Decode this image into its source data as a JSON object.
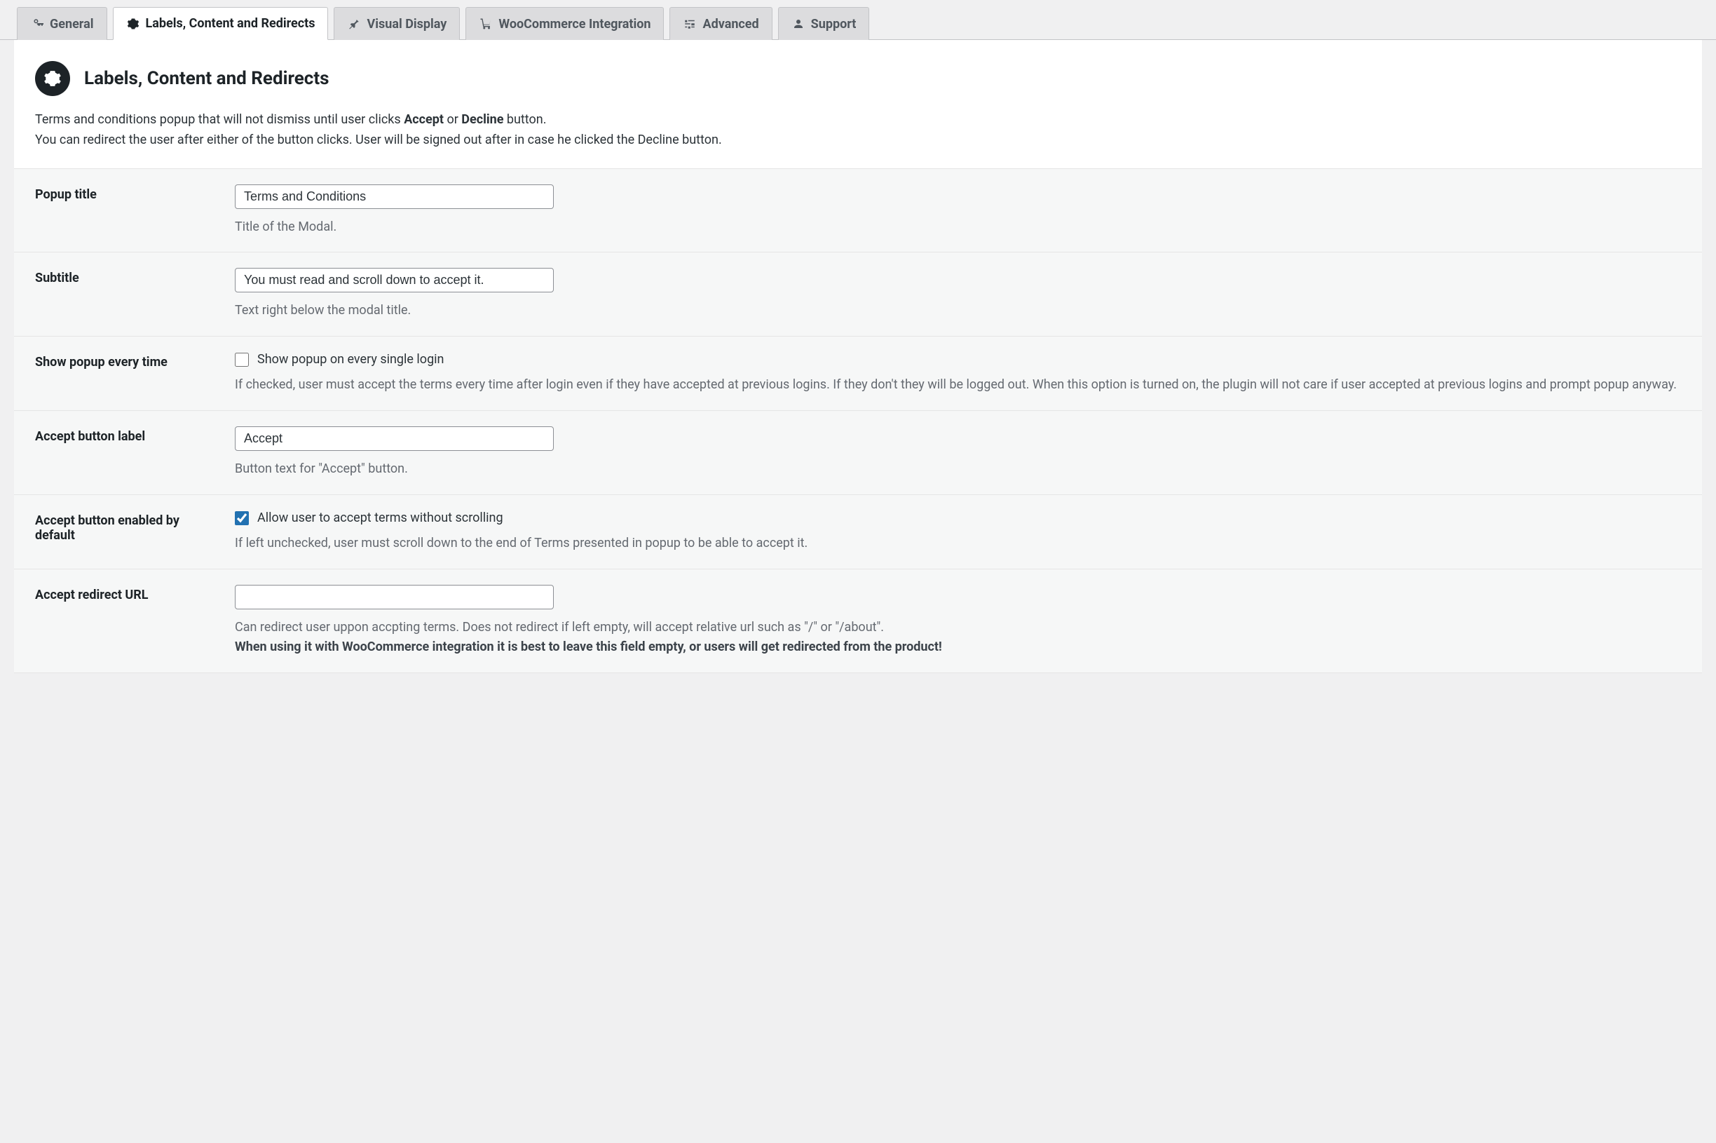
{
  "tabs": [
    {
      "label": "General"
    },
    {
      "label": "Labels, Content and Redirects"
    },
    {
      "label": "Visual Display"
    },
    {
      "label": "WooCommerce Integration"
    },
    {
      "label": "Advanced"
    },
    {
      "label": "Support"
    }
  ],
  "panel": {
    "title": "Labels, Content and Redirects",
    "desc_line1_pre": "Terms and conditions popup that will not dismiss until user clicks ",
    "desc_accept": "Accept",
    "desc_or": " or ",
    "desc_decline": "Decline",
    "desc_line1_post": " button.",
    "desc_line2": "You can redirect the user after either of the button clicks. User will be signed out after in case he clicked the Decline button."
  },
  "fields": {
    "popup_title": {
      "label": "Popup title",
      "value": "Terms and Conditions",
      "help": "Title of the Modal."
    },
    "subtitle": {
      "label": "Subtitle",
      "value": "You must read and scroll down to accept it.",
      "help": "Text right below the modal title."
    },
    "show_every_time": {
      "label": "Show popup every time",
      "checkbox_label": "Show popup on every single login",
      "help": "If checked, user must accept the terms every time after login even if they have accepted at previous logins. If they don't they will be logged out. When this option is turned on, the plugin will not care if user accepted at previous logins and prompt popup anyway."
    },
    "accept_label": {
      "label": "Accept button label",
      "value": "Accept",
      "help": "Button text for \"Accept\" button."
    },
    "accept_enabled": {
      "label": "Accept button enabled by default",
      "checkbox_label": "Allow user to accept terms without scrolling",
      "help": "If left unchecked, user must scroll down to the end of Terms presented in popup to be able to accept it."
    },
    "accept_redirect": {
      "label": "Accept redirect URL",
      "value": "",
      "help_line1": "Can redirect user uppon accpting terms. Does not redirect if left empty, will accept relative url such as \"/\" or \"/about\".",
      "help_line2": "When using it with WooCommerce integration it is best to leave this field empty, or users will get redirected from the product!"
    }
  }
}
